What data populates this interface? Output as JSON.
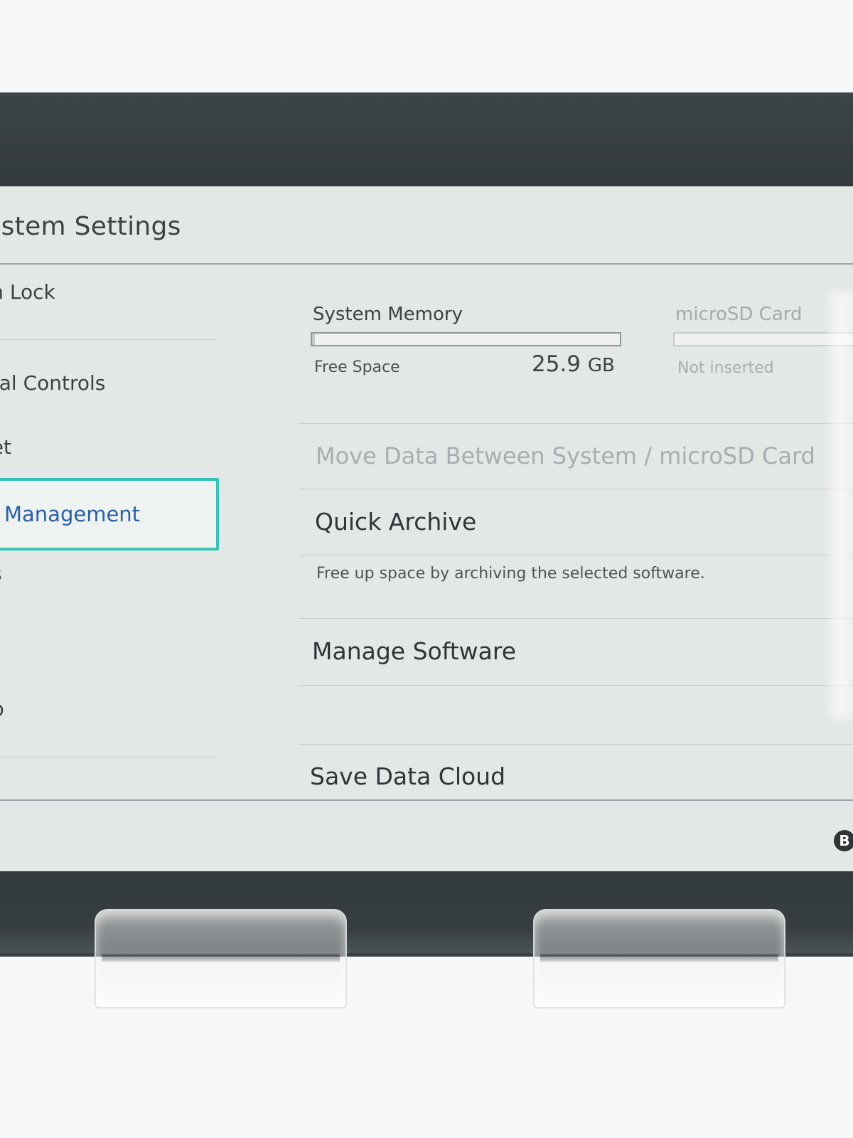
{
  "header": {
    "title": "ystem Settings"
  },
  "sidebar": {
    "items": [
      {
        "label": "en Lock"
      },
      {
        "label": "ntal Controls"
      },
      {
        "label": "net"
      },
      {
        "label": "Management",
        "selected": true
      },
      {
        "label": "s"
      },
      {
        "label": "p"
      }
    ]
  },
  "storage": {
    "system": {
      "title": "System Memory",
      "free_label": "Free Space",
      "free_value": "25.9",
      "free_unit": "GB",
      "used_fraction": 0.01
    },
    "microsd": {
      "title": "microSD Card",
      "status": "Not inserted"
    }
  },
  "menu": {
    "move_data": "Move Data Between System / microSD Card",
    "quick_archive": "Quick Archive",
    "quick_archive_desc": "Free up space by archiving the selected software.",
    "manage_software": "Manage Software",
    "save_data_cloud": "Save Data Cloud"
  },
  "footer": {
    "back_button": "B"
  },
  "colors": {
    "selection_border": "#34c3b7",
    "selected_text": "#2b5fa8",
    "screen_bg": "#e3e7e6",
    "bezel": "#2b3134"
  }
}
